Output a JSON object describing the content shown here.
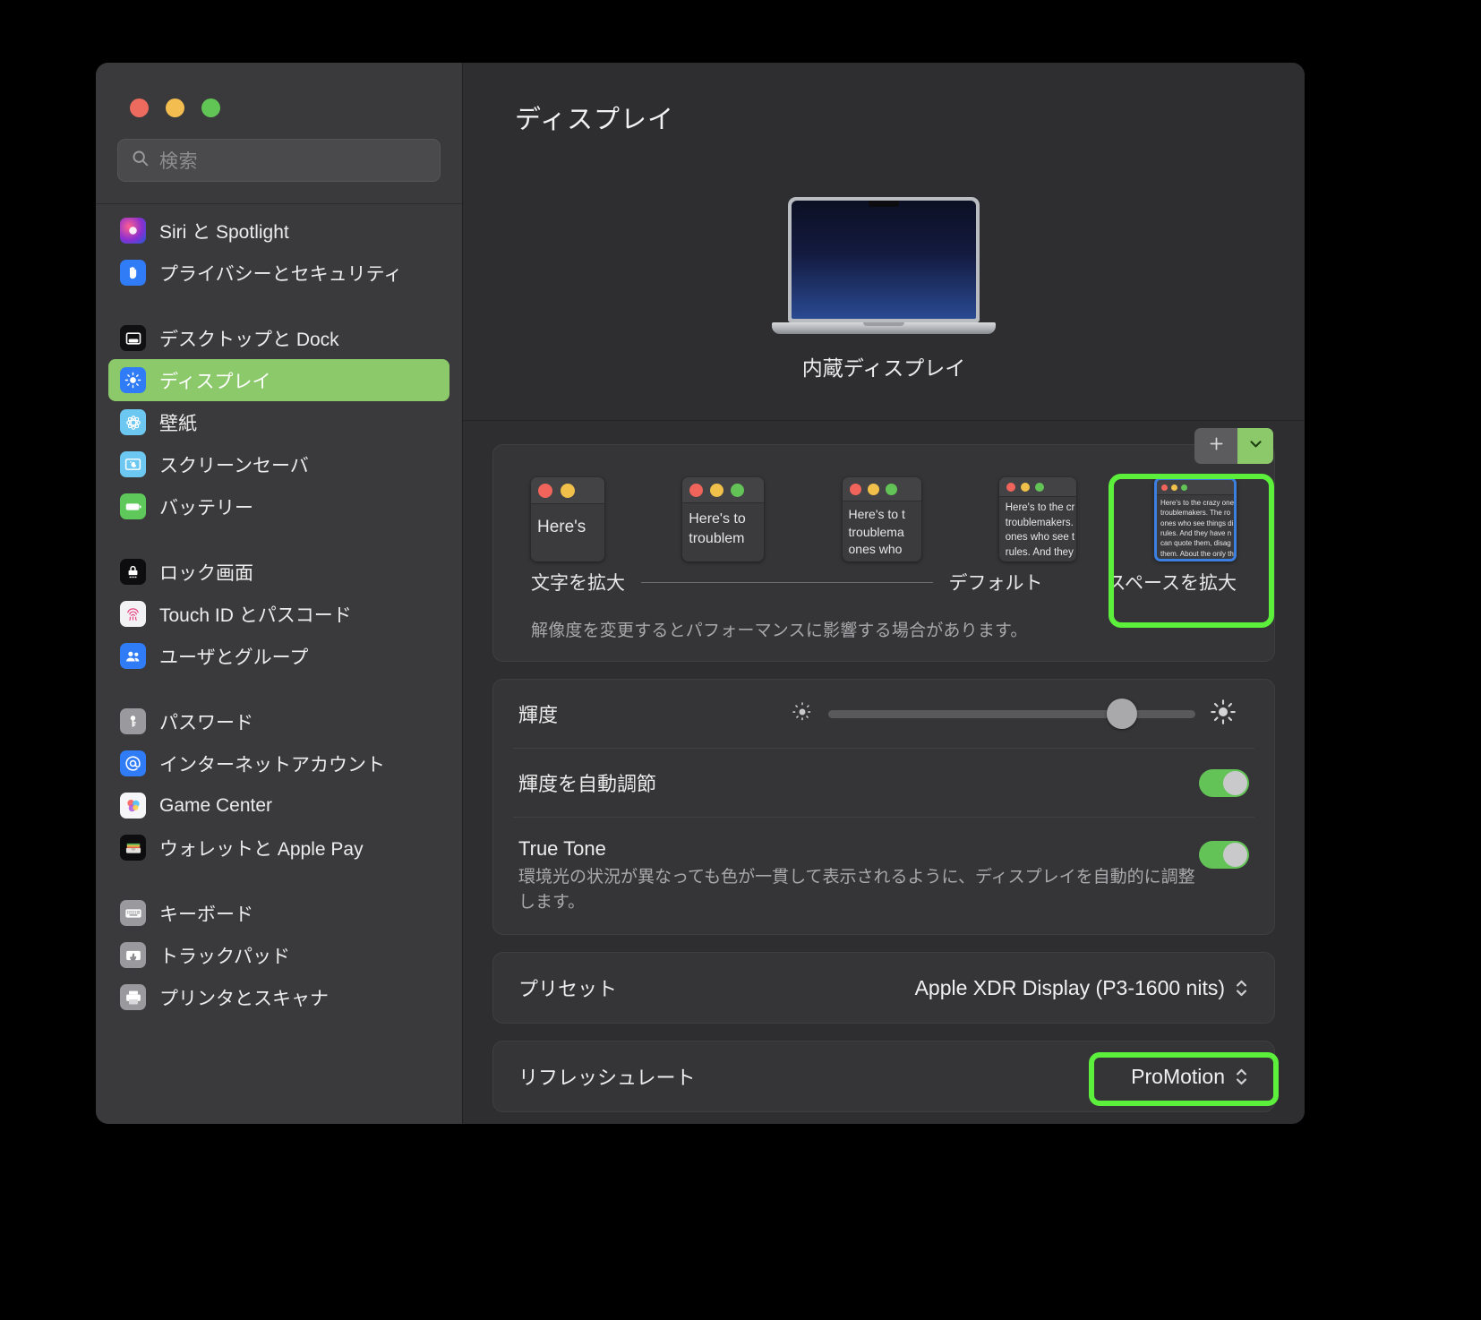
{
  "window": {
    "traffic_lights": [
      "close",
      "minimize",
      "zoom"
    ]
  },
  "search": {
    "placeholder": "検索",
    "icon": "search-icon"
  },
  "sidebar": {
    "groups": [
      {
        "items": [
          {
            "label": "Siri と Spotlight",
            "icon": "siri-icon",
            "active": false
          },
          {
            "label": "プライバシーとセキュリティ",
            "icon": "privacy-hand-icon",
            "active": false
          }
        ]
      },
      {
        "items": [
          {
            "label": "デスクトップと Dock",
            "icon": "desktop-dock-icon",
            "active": false
          },
          {
            "label": "ディスプレイ",
            "icon": "display-brightness-icon",
            "active": true
          },
          {
            "label": "壁紙",
            "icon": "wallpaper-icon",
            "active": false
          },
          {
            "label": "スクリーンセーバ",
            "icon": "screensaver-icon",
            "active": false
          },
          {
            "label": "バッテリー",
            "icon": "battery-icon",
            "active": false
          }
        ]
      },
      {
        "items": [
          {
            "label": "ロック画面",
            "icon": "lock-icon",
            "active": false
          },
          {
            "label": "Touch ID とパスコード",
            "icon": "touch-id-icon",
            "active": false
          },
          {
            "label": "ユーザとグループ",
            "icon": "users-groups-icon",
            "active": false
          }
        ]
      },
      {
        "items": [
          {
            "label": "パスワード",
            "icon": "key-icon",
            "active": false
          },
          {
            "label": "インターネットアカウント",
            "icon": "at-sign-icon",
            "active": false
          },
          {
            "label": "Game Center",
            "icon": "game-center-icon",
            "active": false
          },
          {
            "label": "ウォレットと Apple Pay",
            "icon": "wallet-icon",
            "active": false
          }
        ]
      },
      {
        "items": [
          {
            "label": "キーボード",
            "icon": "keyboard-icon",
            "active": false
          },
          {
            "label": "トラックパッド",
            "icon": "trackpad-icon",
            "active": false
          },
          {
            "label": "プリンタとスキャナ",
            "icon": "printer-icon",
            "active": false
          }
        ]
      }
    ]
  },
  "main": {
    "title": "ディスプレイ",
    "display_name": "内蔵ディスプレイ",
    "add_button": {
      "icon": "plus-icon",
      "chevron": "chevron-down-icon"
    },
    "resolution": {
      "options": [
        {
          "label": "文字を拡大",
          "selected": false,
          "preview_text": "Here's"
        },
        {
          "label": "",
          "selected": false,
          "preview_text": "Here's to\ntroublem"
        },
        {
          "label": "",
          "selected": false,
          "preview_text": "Here's to t\ntroublema\nones who"
        },
        {
          "label": "デフォルト",
          "selected": false,
          "preview_text": "Here's to the cr\ntroublemakers.\nones who see t\nrules. And they"
        },
        {
          "label": "スペースを拡大",
          "selected": true,
          "preview_text": "Here's to the crazy one\ntroublemakers. The ro\nones who see things di\nrules. And they have n\ncan quote them, disag\nthem. About the only th\nBecause they change t"
        }
      ],
      "hint": "解像度を変更するとパフォーマンスに影響する場合があります。"
    },
    "brightness": {
      "label": "輝度",
      "value_percent": 80,
      "low_icon": "brightness-low-icon",
      "high_icon": "brightness-high-icon"
    },
    "auto_brightness": {
      "label": "輝度を自動調節",
      "enabled": true
    },
    "true_tone": {
      "label": "True Tone",
      "description": "環境光の状況が異なっても色が一貫して表示されるように、ディスプレイを自動的に調整します。",
      "enabled": true
    },
    "preset": {
      "label": "プリセット",
      "value": "Apple XDR Display (P3-1600 nits)"
    },
    "refresh_rate": {
      "label": "リフレッシュレート",
      "value": "ProMotion"
    }
  },
  "highlights": {
    "color": "#5cf03c",
    "targets": [
      "more-space-resolution-option",
      "refresh-rate-popup"
    ]
  }
}
